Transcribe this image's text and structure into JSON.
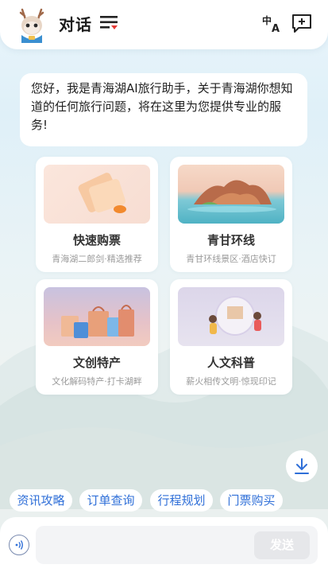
{
  "header": {
    "title": "对话",
    "avatar_icon": "deer-mascot-avatar",
    "menu_icon": "menu-lines-icon",
    "translate_icon": "translate-icon",
    "new_chat_icon": "new-chat-icon"
  },
  "greeting": "您好，我是青海湖AI旅行助手，关于青海湖你想知道的任何旅行问题，将在这里为您提供专业的服务!",
  "cards": [
    {
      "title": "快速购票",
      "subtitle": "青海湖二郎剑·精选推荐",
      "icon": "ticket-image"
    },
    {
      "title": "青甘环线",
      "subtitle": "青甘环线景区·酒店快订",
      "icon": "lake-island-image"
    },
    {
      "title": "文创特产",
      "subtitle": "文化解码特产·打卡湖畔",
      "icon": "gift-bags-image"
    },
    {
      "title": "人文科普",
      "subtitle": "薪火相传文明·惊现印记",
      "icon": "globe-children-image"
    }
  ],
  "download_icon": "download-icon",
  "chips": [
    "资讯攻略",
    "订单查询",
    "行程规划",
    "门票购买"
  ],
  "input": {
    "placeholder": "",
    "voice_icon": "voice-wave-icon",
    "send_label": "发送"
  },
  "colors": {
    "accent": "#2f6fd8",
    "menu_dot": "#e53935",
    "send_disabled": "#e6e7ea"
  }
}
